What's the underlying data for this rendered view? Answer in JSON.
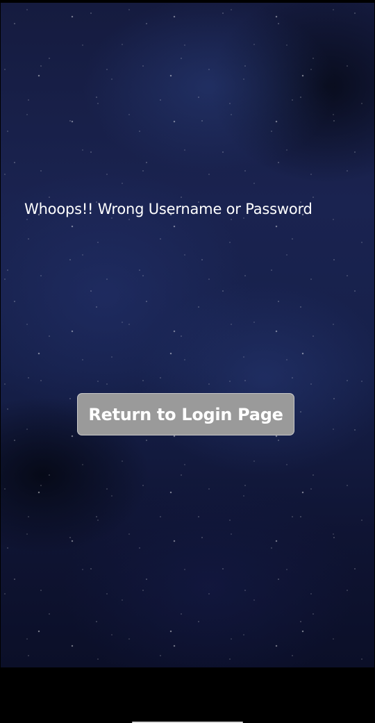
{
  "error": {
    "message": "Whoops!! Wrong Username or Password"
  },
  "actions": {
    "return_label": "Return to Login Page"
  },
  "colors": {
    "background": "#16204a",
    "button_bg": "#9a9a9a",
    "text": "#ffffff"
  }
}
